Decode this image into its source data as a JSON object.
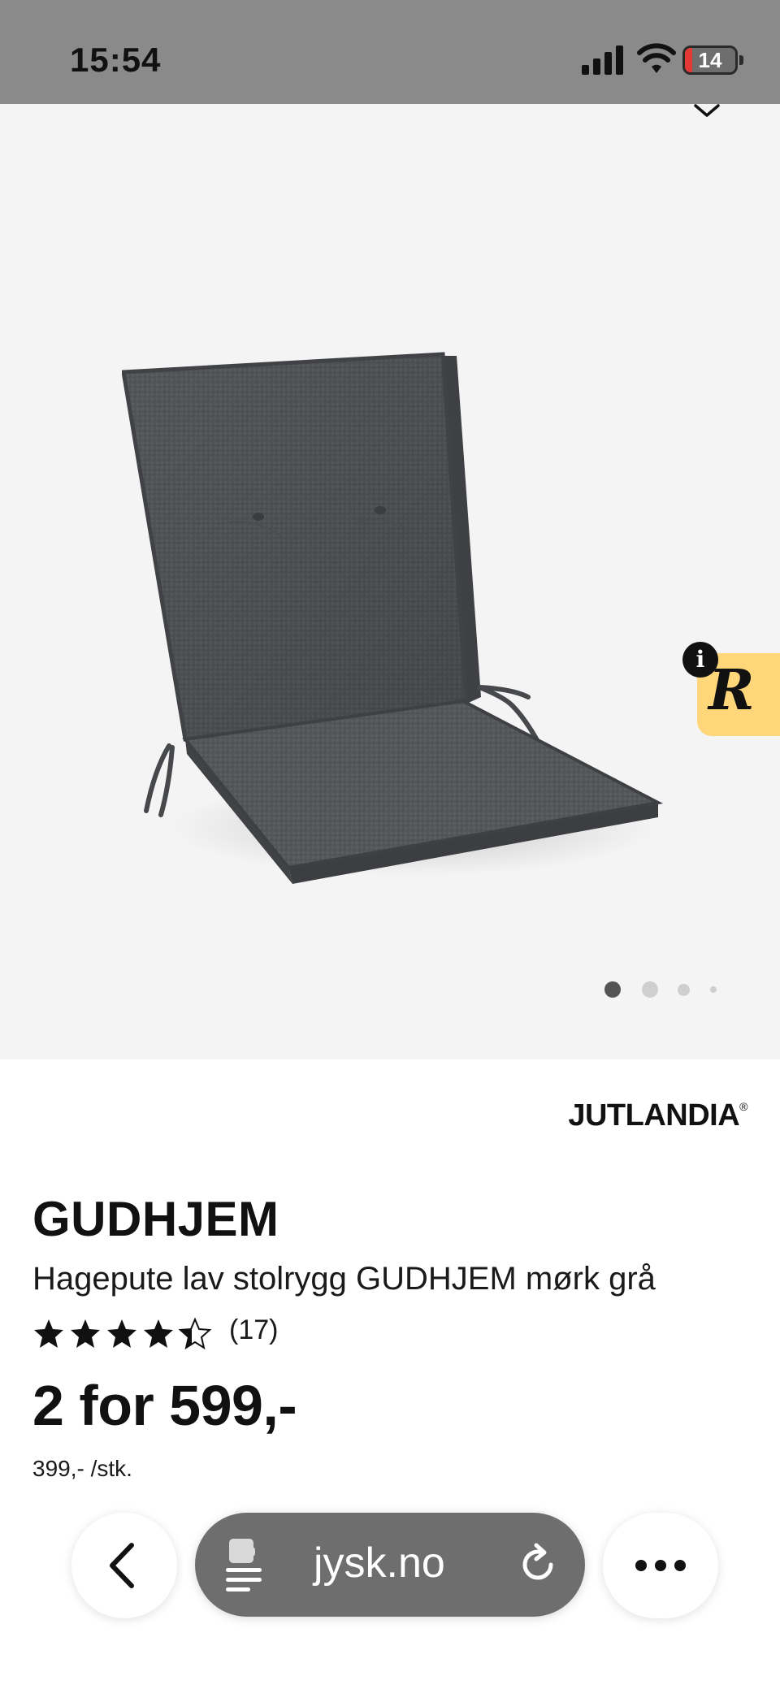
{
  "status_bar": {
    "time": "15:54",
    "battery_level": "14",
    "signal_icon": "cellular-signal-icon",
    "wifi_icon": "wifi-icon"
  },
  "gallery": {
    "background": "#f4f4f4",
    "image": "grey-garden-chair-cushion",
    "slide_count": 4,
    "active_slide": 1,
    "badge_letter": "R",
    "info_label": "i"
  },
  "product": {
    "brand": "JUTLANDIA",
    "brand_mark": "®",
    "name": "GUDHJEM",
    "description": "Hagepute lav stolrygg GUDHJEM mørk grå",
    "rating": 4.5,
    "rating_max": 5,
    "review_count": "(17)",
    "price": "2 for 599,-",
    "unit_price": "399,- /stk."
  },
  "browser": {
    "url": "jysk.no",
    "back_icon": "chevron-left-icon",
    "page_icon": "page-menu-icon",
    "reload_icon": "reload-icon",
    "more_icon": "more-dots-icon"
  }
}
